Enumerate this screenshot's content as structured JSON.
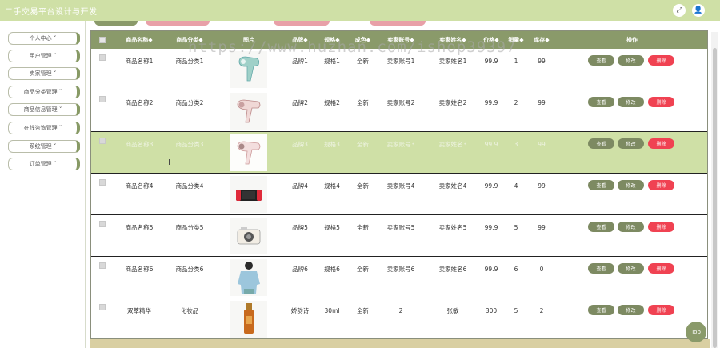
{
  "app": {
    "title": "二手交易平台设计与开发"
  },
  "header": {
    "fullscreen_icon": "⤢",
    "user_icon": "👤"
  },
  "sidebar": {
    "items": [
      {
        "label": "个人中心"
      },
      {
        "label": "用户管理"
      },
      {
        "label": "卖家管理"
      },
      {
        "label": "商品分类管理"
      },
      {
        "label": "商品信息管理"
      },
      {
        "label": "在线咨询管理"
      },
      {
        "label": "系统管理"
      },
      {
        "label": "订单管理"
      }
    ]
  },
  "table": {
    "headers": {
      "name": "商品名称◆",
      "category": "商品分类◆",
      "image": "图片",
      "brand": "品牌◆",
      "spec": "规格◆",
      "condition": "成色◆",
      "seller_account": "卖家账号◆",
      "seller_name": "卖家姓名◆",
      "price": "价格◆",
      "sales": "销量◆",
      "stock": "库存◆",
      "actions": "操作"
    },
    "buttons": {
      "view": "查看",
      "edit": "修改",
      "delete": "删除"
    },
    "rows": [
      {
        "name": "商品名称1",
        "category": "商品分类1",
        "brand": "品牌1",
        "spec": "规格1",
        "condition": "全新",
        "seller_account": "卖家账号1",
        "seller_name": "卖家姓名1",
        "price": "99.9",
        "sales": "1",
        "stock": "99"
      },
      {
        "name": "商品名称2",
        "category": "商品分类2",
        "brand": "品牌2",
        "spec": "规格2",
        "condition": "全新",
        "seller_account": "卖家账号2",
        "seller_name": "卖家姓名2",
        "price": "99.9",
        "sales": "2",
        "stock": "99"
      },
      {
        "name": "商品名称3",
        "category": "商品分类3",
        "brand": "品牌3",
        "spec": "规格3",
        "condition": "全新",
        "seller_account": "卖家账号3",
        "seller_name": "卖家姓名3",
        "price": "99.9",
        "sales": "3",
        "stock": "99"
      },
      {
        "name": "商品名称4",
        "category": "商品分类4",
        "brand": "品牌4",
        "spec": "规格4",
        "condition": "全新",
        "seller_account": "卖家账号4",
        "seller_name": "卖家姓名4",
        "price": "99.9",
        "sales": "4",
        "stock": "99"
      },
      {
        "name": "商品名称5",
        "category": "商品分类5",
        "brand": "品牌5",
        "spec": "规格5",
        "condition": "全新",
        "seller_account": "卖家账号5",
        "seller_name": "卖家姓名5",
        "price": "99.9",
        "sales": "5",
        "stock": "99"
      },
      {
        "name": "商品名称6",
        "category": "商品分类6",
        "brand": "品牌6",
        "spec": "规格6",
        "condition": "全新",
        "seller_account": "卖家账号6",
        "seller_name": "卖家姓名6",
        "price": "99.9",
        "sales": "6",
        "stock": "0"
      },
      {
        "name": "双萃精华",
        "category": "化妆品",
        "brand": "娇韵诗",
        "spec": "30ml",
        "condition": "全新",
        "seller_account": "2",
        "seller_name": "张敏",
        "price": "300",
        "sales": "5",
        "stock": "2"
      }
    ]
  },
  "watermark": "https://www.huzhan.com/ishop39397",
  "back_to_top": "Top",
  "colors": {
    "accent": "#8a9a6a",
    "header_bar": "#cfe0a6",
    "danger": "#f04252",
    "highlight_row": "#cfe0a6"
  }
}
